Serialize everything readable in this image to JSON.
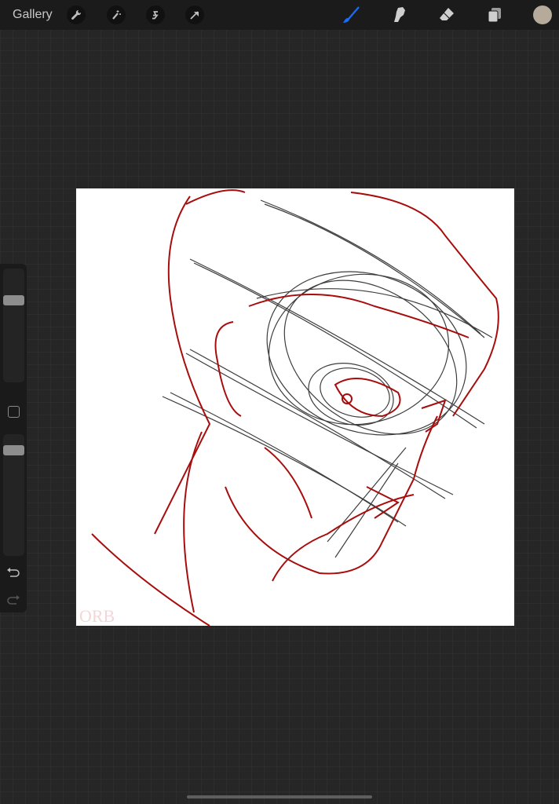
{
  "toolbar": {
    "gallery_label": "Gallery",
    "left_tools": [
      "wrench-icon",
      "magic-wand-icon",
      "selection-icon",
      "transform-arrow-icon"
    ],
    "right_tools": [
      "brush-icon",
      "smudge-icon",
      "eraser-icon",
      "layers-icon"
    ],
    "active_tool": "brush",
    "accent_color": "#1a6cff",
    "current_color": "#b6aa9a"
  },
  "sidebar": {
    "brush_size": 0.74,
    "opacity": 0.9
  },
  "canvas": {
    "signature": "ORB",
    "stroke_colors": [
      "#a80d0d",
      "#1c1c1c"
    ]
  }
}
